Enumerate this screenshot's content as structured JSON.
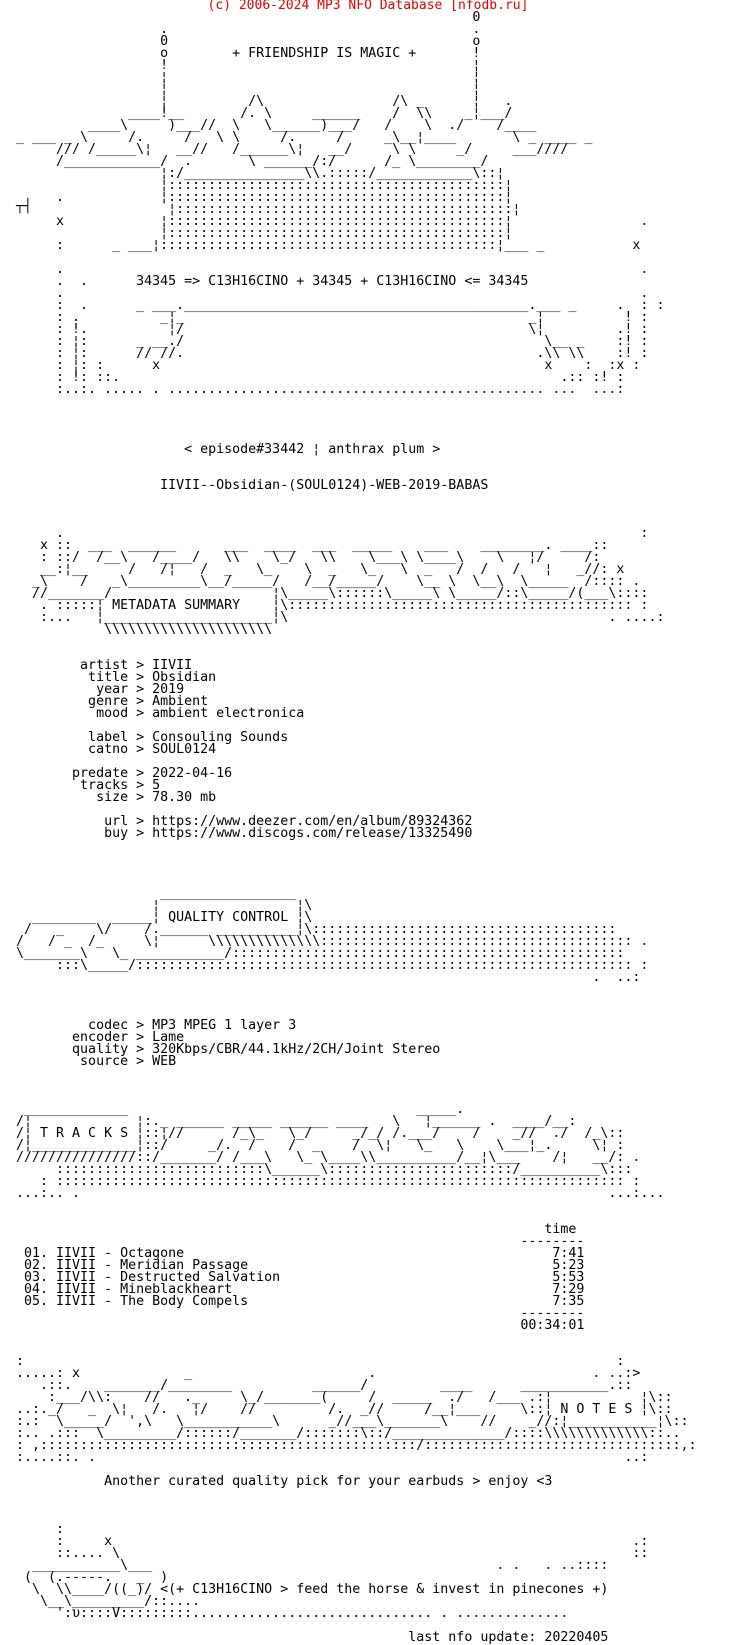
{
  "header": {
    "copyright": "(c) 2006-2024 MP3 NFO Database [nfodb.ru]",
    "color": "#e00000"
  },
  "stray_glyph": "┬┤",
  "nfo": {
    "lines": [
      "                                                           0",
      "                    .                                      .",
      "                    0                                      o",
      "                    o        + FRIENDSHIP IS MAGIC +       !",
      "                    !                                      ¦",
      "                    ¦                                      ¦",
      "                    ¦                                      ¦",
      "                    ¦          /\\                /\\ _      ¦   .",
      "                ____!__       /. \\     ______    /  \\\\    _¦___/",
      "           ____\\     )___//  \\   \\______)___/   /    \\  ./    /____",
      "  _ ___ _ \\     /.     /   \\ \\     /.     /     _\\__¦____       \\ _ ____ _",
      "       /// /_____\\¦   __//   /______\\¦   __/     \\ \\     _/     ___////",
      "       /____________/  .       \\ ______/:/      /_ \\________/",
      "                    ¦:/_______________\\\\.:::::/____________\\::¦",
      "                    ¦::::::::::::::::::::::::::::::::::::::::::¦",
      "       .            ¦::::::::::::::::::::::::::::::::::::::::::¦",
      "                     ¦::::::::::::::::::::::::::::::::::::::::::¦",
      "       x            ¦::::::::::::::::::::::::::::::::::::::::::¦                .",
      "                    ¦::::::::::::::::::::::::::::::::::::::::::¦",
      "       :      _ ___¦::::::::::::::::::::::::::::::::::::::::::¦___ _           x",
      "",
      "       .                                                                        .",
      "       .  .      34345 => C13H16CINO + 34345 + C13H16CINO <= 34345",
      "       .                                                                        .",
      "       :  .      _ ___.___________________________________________.___ _     .  : :",
      "       : .          _¦_                                           _¦          ! :",
      "       : !.          ¦/                                           \\¦         .! :",
      "       : ¦:      _ __./                                             \\__ _    :! :",
      "       : ¦:      // //.                                            .\\\\ \\\\    :! :",
      "       : ¦: :      x                                                x    :  :x :",
      "       : !: ::.                                                       .:: :! :",
      "       :..:. ..... . ............................................... ...  ...:",
      "",
      "",
      "",
      "",
      "                       < episode#33442 ¦ anthrax plum >",
      "",
      "",
      "                    IIVII--Obsidian-(SOUL0124)-WEB-2019-BABAS",
      "",
      "",
      "",
      "       .                                                                        :",
      "     x ::  ___  ______      ___  ____  ___  _____    ___    ________. ____::",
      "     : ::/  /__\\   /____/   \\\\    \\_/   \\\\    \\___\\ \\____\\    \\   ¦/     /:",
      "     __:¦__     /   /¦   /  _   \\_    \\  _   \\_   \\  _   /  /   /   ¦   _//: x",
      "    _\\    /   _\\_________\\__/_____/   /__/_____/    \\__ \\  \\__\\  \\_____  /:::: .",
      "    //_______/                    ¦\\_____\\::::::\\_____\\ \\_____/::\\_____/(___\\::::",
      "     . :::::¦ METADATA SUMMARY    ¦\\::::::::::::::::::::::::::::::::::::::::::: :",
      "     :...   ¦_____________________¦\\                                        . ....:",
      "             \\\\\\\\\\\\\\\\\\\\\\\\\\\\\\\\\\\\\\\\\\",
      "",
      "",
      "          artist > IIVII",
      "           title > Obsidian",
      "            year > 2019",
      "           genre > Ambient",
      "            mood > ambient electronica",
      "",
      "           label > Consouling Sounds",
      "           catno > SOUL0124",
      "",
      "         predate > 2022-04-16",
      "          tracks > 5",
      "            size > 78.30 mb",
      "",
      "             url > https://www.deezer.com/en/album/89324362",
      "             buy > https://www.discogs.com/release/13325490",
      "",
      "",
      "",
      "",
      "                    _________________",
      "                   ¦                 ¦\\",
      "    ________  _____¦ QUALITY CONTROL ¦\\",
      "   /   _    \\/    /.______ __________¦\\::::::::::::::::::::::::::::::::::::::",
      "  /   / _  /_     \\¦      \\\\\\\\\\\\\\\\\\\\\\\\\\\\::::::::::::::::::::::::::::::::::::::: .",
      "  \\_______\\   \\_ ___________/:::::::::::::::::::::::::::::::::::::::::::::::::",
      "       :::\\_____/:::::::::::::::::::::::::::::::::::::::::::::::::::::::::::::: :",
      "                                                                          .  ..:",
      "",
      "",
      "",
      "           codec > MP3 MPEG 1 layer 3",
      "         encoder > Lame",
      "         quality > 320Kbps/CBR/44.1kHz/2CH/Joint Stereo",
      "          source > WEB",
      "",
      "",
      "",
      "   _____________                                    _____.",
      "  /¦             ¦:._ ______ _____ ______ ____   \\   ¦______ .  ____/__:",
      "  /¦ T R A C K S ¦::¦//      /_\\_   \\_/     _/_/ /.___/    /    _//  ./  /_\\::",
      "  /¦_____________¦::/     _/.  /    /  _    /  \\¦   \\_   \\    \\___¦_.     \\¦ :",
      "  ///////////////::/_______/ /___\\   \\_ \\____\\\\__________/__¦\\___    /¦   __/: .",
      "       ::::::::::::::::::::::::::\\______\\:::::::::::::::::::::::/__________\\:::",
      "     : ::::::::::::::::::::::::::::::::::::::::::::::::::::::::::::::::::::::: :",
      "  ...:.. .                                                                  ...:...",
      "",
      "",
      "                                                                    time",
      "                                                                 --------",
      "   01. IIVII - Octagone                                              7:41",
      "   02. IIVII - Meridian Passage                                      5:23",
      "   03. IIVII - Destructed Salvation                                  5:53",
      "   04. IIVII - Mineblackheart                                        7:29",
      "   05. IIVII - The Body Compels                                      7:35",
      "                                                                 --------",
      "                                                                 00:34:01",
      "",
      "",
      "  :                                                                          :",
      "  .....: x             _                      .                           . ..:>",
      "     .::.    _______/________          ______/         ____      ___________.::",
      "      :___/\\\\:    //   ._     \\_/_______(     /  _____  ./   /___ .:¦           ¦\\::",
      "  ..:._/   _  \\¦   /.   ¦/    //         /.  _//     /__¦___     \\::¦ N O T E S ¦\\::",
      "  :.:  \\_____/  ',\\   \\___________\\      _//___\\_______\\    //    _//:¦___________¦\\::",
      "  :.. .:::  \\_________/::::::/_______/:::::::\\::/______________/::::\\\\\\\\\\\\\\\\\\\\\\\\\\::..",
      "  : ,:::::::::::::::::::::::::::::::::::::::::::::::/::::::::::::::::::::::::::::::::,:",
      "  :....::. .                                                                  ..:",
      "",
      "             Another curated quality pick for your earbuds > enjoy <3",
      "",
      "",
      "",
      "       :",
      "       :     x                                                                 .:",
      "       ::.... \\                                                                ::",
      "    ___________\\___                                           . .   . ..::::",
      "   (  (.-----.   _  )",
      "    \\  \\\\____/((_)/ <(+ C13H16CINO > feed the horse & invest in pinecones +)",
      "     \\__\\_________/::....",
      "       ':υ::::V:::::::::.............................. . ..............",
      "",
      "                                                   last nfo update: 20220405"
    ]
  }
}
